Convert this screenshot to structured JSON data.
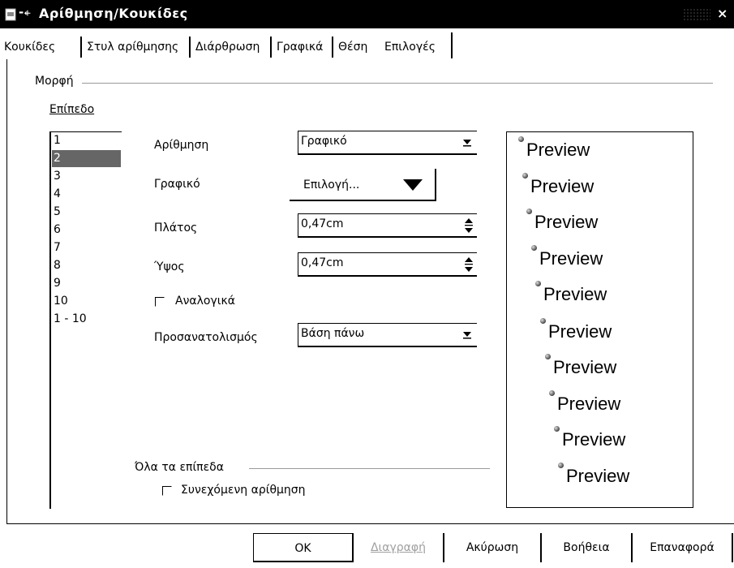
{
  "window": {
    "title": "Αρίθμηση/Κουκίδες",
    "pin_glyph": "-⍅",
    "close_glyph": "×"
  },
  "tabs": [
    {
      "label": "Κουκίδες",
      "active": false
    },
    {
      "label": "Στυλ αρίθμησης",
      "active": false
    },
    {
      "label": "Διάρθρωση",
      "active": false
    },
    {
      "label": "Γραφικά",
      "active": false
    },
    {
      "label": "Θέση",
      "active": false
    },
    {
      "label": "Επιλογές",
      "active": true
    }
  ],
  "format_section": {
    "label": "Μορφή",
    "level_label": "Επίπεδο",
    "levels": [
      "1",
      "2",
      "3",
      "4",
      "5",
      "6",
      "7",
      "8",
      "9",
      "10",
      "1 - 10"
    ],
    "selected_level": "2"
  },
  "fields": {
    "numbering": {
      "label": "Αρίθμηση",
      "value": "Γραφικό"
    },
    "graphic": {
      "label": "Γραφικό",
      "button_label": "Επιλογή..."
    },
    "width": {
      "label": "Πλάτος",
      "value": "0,47cm"
    },
    "height": {
      "label": "Ύψος",
      "value": "0,47cm"
    },
    "proportional": {
      "label": "Αναλογικά",
      "checked": false
    },
    "alignment": {
      "label": "Προσανατολισμός",
      "value": "Βάση πάνω"
    }
  },
  "all_levels": {
    "label": "Όλα τα επίπεδα",
    "continuous": {
      "label": "Συνεχόμενη αρίθμηση",
      "checked": false
    }
  },
  "preview": {
    "items": [
      "Preview",
      "Preview",
      "Preview",
      "Preview",
      "Preview",
      "Preview",
      "Preview",
      "Preview",
      "Preview",
      "Preview"
    ]
  },
  "buttons": {
    "ok": "OK",
    "delete": "Διαγραφή",
    "cancel": "Ακύρωση",
    "help": "Βοήθεια",
    "reset": "Επαναφορά"
  },
  "colors": {
    "titlebar": "#000000",
    "selection": "#666666",
    "disabled_text": "#a0a0a0"
  }
}
